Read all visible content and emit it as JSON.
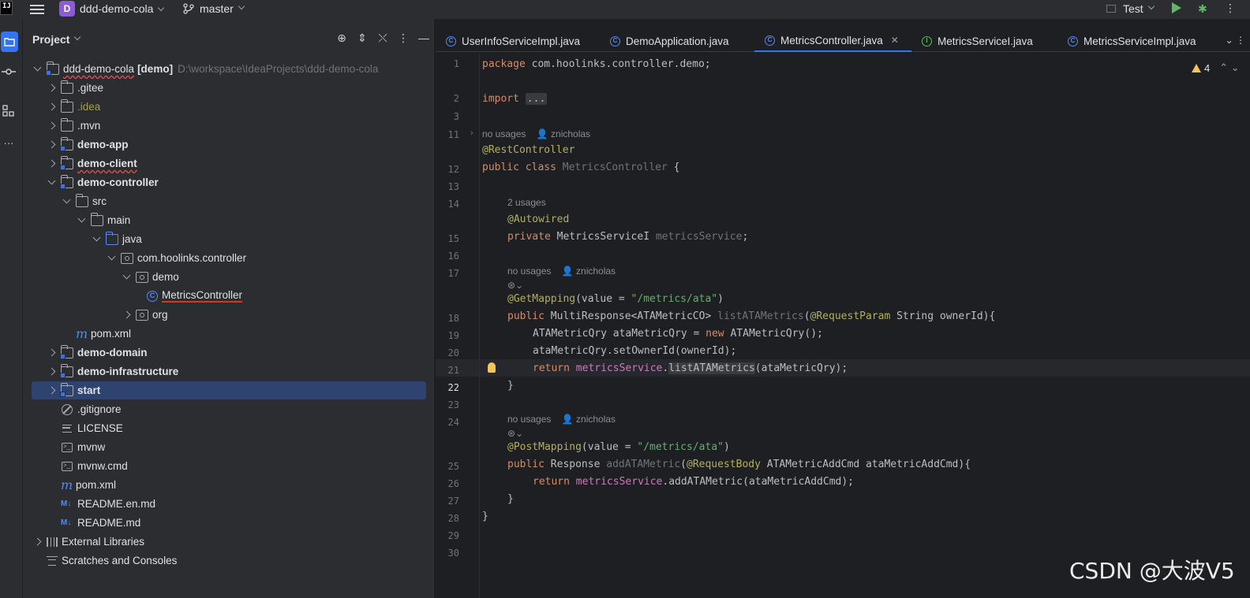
{
  "titlebar": {
    "logo": "IJ",
    "project_badge": "D",
    "project_name": "ddd-demo-cola",
    "branch": "master",
    "run_config": "Test"
  },
  "panel": {
    "title": "Project"
  },
  "tree": [
    {
      "label": "ddd-demo-cola",
      "suffix": "[demo]",
      "path": "D:\\workspace\\IdeaProjects\\ddd-demo-cola"
    },
    {
      "label": ".gitee"
    },
    {
      "label": ".idea"
    },
    {
      "label": ".mvn"
    },
    {
      "label": "demo-app"
    },
    {
      "label": "demo-client"
    },
    {
      "label": "demo-controller"
    },
    {
      "label": "src"
    },
    {
      "label": "main"
    },
    {
      "label": "java"
    },
    {
      "label": "com.hoolinks.controller"
    },
    {
      "label": "demo"
    },
    {
      "label": "MetricsController"
    },
    {
      "label": "org"
    },
    {
      "label": "pom.xml"
    },
    {
      "label": "demo-domain"
    },
    {
      "label": "demo-infrastructure"
    },
    {
      "label": "start"
    },
    {
      "label": ".gitignore"
    },
    {
      "label": "LICENSE"
    },
    {
      "label": "mvnw"
    },
    {
      "label": "mvnw.cmd"
    },
    {
      "label": "pom.xml"
    },
    {
      "label": "README.en.md"
    },
    {
      "label": "README.md"
    },
    {
      "label": "External Libraries"
    },
    {
      "label": "Scratches and Consoles"
    }
  ],
  "tabs": [
    {
      "label": "UserInfoServiceImpl.java"
    },
    {
      "label": "DemoApplication.java"
    },
    {
      "label": "MetricsController.java"
    },
    {
      "label": "MetricsServiceI.java"
    },
    {
      "label": "MetricsServiceImpl.java"
    }
  ],
  "editor": {
    "warning_count": "4",
    "line_numbers": [
      "1",
      "2",
      "3",
      "11",
      "12",
      "13",
      "14",
      "15",
      "16",
      "17",
      "18",
      "19",
      "20",
      "21",
      "22",
      "23",
      "24",
      "25",
      "26",
      "27",
      "28",
      "29",
      "30"
    ],
    "current_line": "22",
    "hints": {
      "no_usages": "no usages",
      "two_usages": "2 usages",
      "author": "znicholas"
    }
  },
  "watermark": "CSDN @大波V5",
  "colors": {
    "accent": "#3574f0",
    "selection": "#2e436e",
    "keyword": "#cf8e6d",
    "annotation": "#b3ae60",
    "string": "#6aab73",
    "field": "#c77dbb"
  }
}
